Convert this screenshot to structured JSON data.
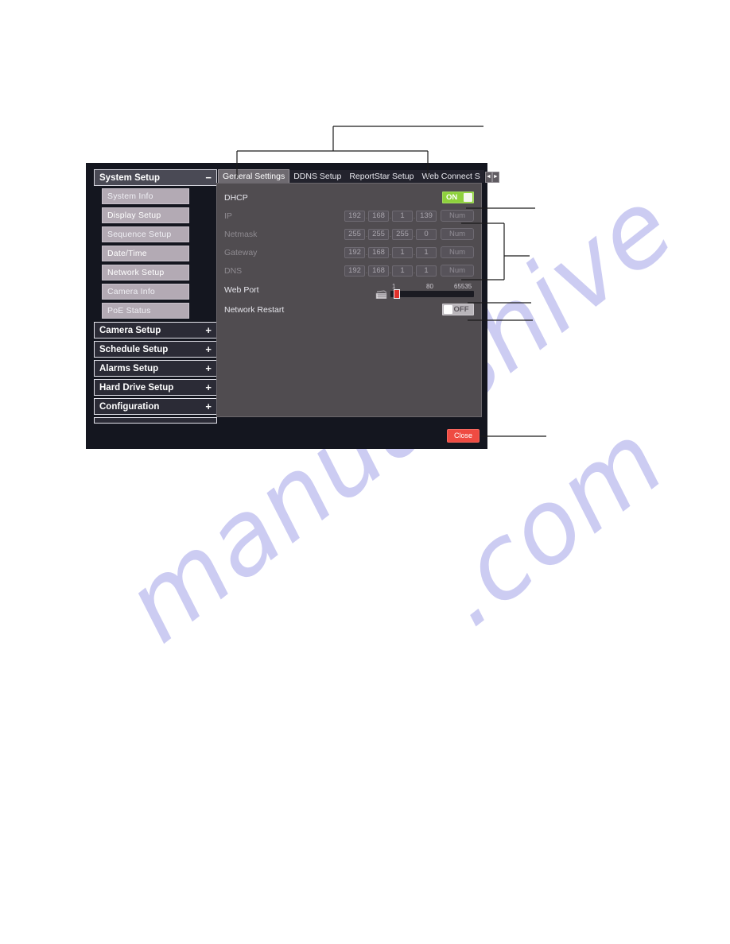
{
  "window": {
    "title": "System Setup Network Setup dialog"
  },
  "sidebar": {
    "header": {
      "label": "System Setup",
      "sign": "−"
    },
    "items": [
      {
        "label": "System Info"
      },
      {
        "label": "Display Setup"
      },
      {
        "label": "Sequence Setup"
      },
      {
        "label": "Date/Time"
      },
      {
        "label": "Network Setup"
      },
      {
        "label": "Camera Info"
      },
      {
        "label": "PoE Status"
      }
    ],
    "collapsed": [
      {
        "label": "Camera Setup",
        "sign": "+"
      },
      {
        "label": "Schedule Setup",
        "sign": "+"
      },
      {
        "label": "Alarms Setup",
        "sign": "+"
      },
      {
        "label": "Hard Drive Setup",
        "sign": "+"
      },
      {
        "label": "Configuration",
        "sign": "+"
      }
    ]
  },
  "tabs": [
    {
      "label": "General Settings",
      "active": true
    },
    {
      "label": "DDNS Setup",
      "active": false
    },
    {
      "label": "ReportStar Setup",
      "active": false
    },
    {
      "label": "Web Connect S",
      "active": false
    }
  ],
  "tab_arrows": {
    "left": "◄",
    "right": "►"
  },
  "settings": {
    "dhcp": {
      "label": "DHCP",
      "state": "ON"
    },
    "ip": {
      "label": "IP",
      "octets": [
        "192",
        "168",
        "1",
        "139"
      ],
      "num_button": "Num"
    },
    "netmask": {
      "label": "Netmask",
      "octets": [
        "255",
        "255",
        "255",
        "0"
      ],
      "num_button": "Num"
    },
    "gateway": {
      "label": "Gateway",
      "octets": [
        "192",
        "168",
        "1",
        "1"
      ],
      "num_button": "Num"
    },
    "dns": {
      "label": "DNS",
      "octets": [
        "192",
        "168",
        "1",
        "1"
      ],
      "num_button": "Num"
    },
    "web_port": {
      "label": "Web Port",
      "min": "1",
      "current": "80",
      "max": "65535",
      "icon": "keyboard-icon"
    },
    "network_restart": {
      "label": "Network Restart",
      "state": "OFF"
    }
  },
  "footer": {
    "close_label": "Close"
  },
  "watermark": {
    "line1": "manualshive",
    "line2": ".com"
  },
  "colors": {
    "window_bg": "#14161f",
    "panel_bg": "#504c50",
    "toggle_on": "#8ed13c",
    "toggle_off": "#b9b5ba",
    "close_red": "#ef4b42",
    "slider_handle": "#e0302a",
    "sidebar_item": "#b3aab4"
  }
}
